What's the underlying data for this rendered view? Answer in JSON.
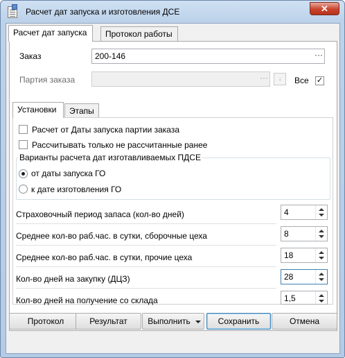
{
  "window": {
    "title": "Расчет дат запуска и изготовления ДСЕ",
    "close_glyph": "✕",
    "frame_color": "#bcd2ea",
    "close_color": "#c7442c"
  },
  "main_tabs": [
    {
      "label": "Расчет дат запуска",
      "active": true
    },
    {
      "label": "Протокол работы",
      "active": false
    }
  ],
  "order": {
    "label": "Заказ",
    "value": "200-146",
    "browse_label": "···"
  },
  "batch": {
    "label": "Партия заказа",
    "value": "",
    "browse_label": "···",
    "clear_label": "↓",
    "all_label": "Все",
    "all_checked": true
  },
  "inner_tabs": [
    {
      "label": "Установки",
      "active": true
    },
    {
      "label": "Этапы",
      "active": false
    }
  ],
  "options": {
    "by_batch_start": {
      "label": "Расчет от Даты запуска партии заказа",
      "checked": false
    },
    "only_not_calculated": {
      "label": "Рассчитывать только не рассчитанные ранее",
      "checked": false
    }
  },
  "variants": {
    "title": "Варианты расчета дат изготавливаемых ПДСЕ",
    "items": [
      {
        "label": "от даты запуска ГО",
        "checked": true
      },
      {
        "label": "к дате изготовления ГО",
        "checked": false
      }
    ]
  },
  "params": [
    {
      "label": "Страховочный период запаса (кол-во дней)",
      "value": "4"
    },
    {
      "label": "Среднее кол-во раб.час. в сутки, сборочные цеха",
      "value": "8"
    },
    {
      "label": "Среднее кол-во раб.час. в сутки, прочие цеха",
      "value": "18"
    },
    {
      "label": "Кол-во дней на закупку (ДЦЗ)",
      "value": "28"
    },
    {
      "label": "Кол-во дней на получение со склада",
      "value": "1,5"
    }
  ],
  "buttons": {
    "protocol": "Протокол",
    "result": "Результат",
    "execute": "Выполнить",
    "save": "Сохранить",
    "cancel": "Отмена"
  },
  "checkmark": "✓"
}
